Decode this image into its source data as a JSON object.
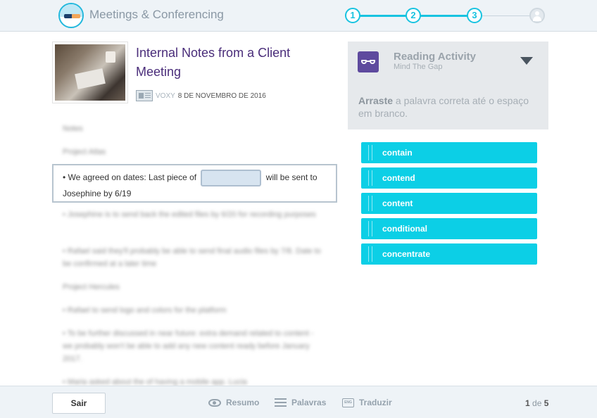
{
  "header": {
    "app_title": "Meetings & Conferencing",
    "steps": [
      "1",
      "2",
      "3"
    ]
  },
  "article": {
    "title": "Internal Notes from a Client Meeting",
    "source": "VOXY",
    "date": "8 DE NOVEMBRO DE 2016"
  },
  "body": {
    "blurred": [
      "Notes",
      "Project Atlas",
      "• Josephine is to send back the edited files by 6/20 for recording purposes",
      "• Rafael said they'll probably be able to send final audio files by 7/8. Date to be confirmed at a later time",
      "Project Hercules",
      "• Rafael to send logo and colors for the platform",
      "• To be further discussed in near future: extra demand related to content - we probably won't be able to add any new content ready before January 2017.",
      "• Maria asked about the                of having a mobile app. Lucia"
    ],
    "active_before": "• We agreed on dates: Last piece of",
    "active_after": "will be sent to Josephine by 6/19"
  },
  "activity": {
    "title": "Reading Activity",
    "subtitle": "Mind The Gap",
    "instruction_bold": "Arraste",
    "instruction_rest": "a palavra correta até o espaço em branco."
  },
  "choices": [
    "contain",
    "contend",
    "content",
    "conditional",
    "concentrate"
  ],
  "footer": {
    "exit_label": "Sair",
    "summary_label": "Resumo",
    "words_label": "Palavras",
    "translate_label": "Traduzir",
    "translate_icon_text": "ENG",
    "page_current": "1",
    "page_sep": "de",
    "page_total": "5"
  }
}
